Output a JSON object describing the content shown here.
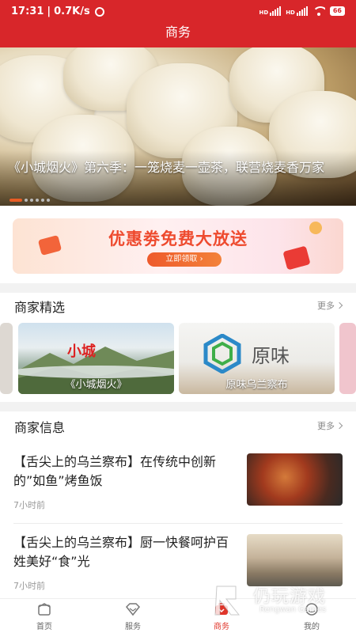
{
  "status_bar": {
    "time": "17:31",
    "speed": "0.7K/s",
    "battery": "66"
  },
  "header": {
    "title": "商务"
  },
  "banner": {
    "caption": "《小城烟火》第六季：一笼烧麦一壶茶，联营烧麦香万家",
    "page_indicator": {
      "total": 6,
      "current": 1
    }
  },
  "coupon": {
    "headline": "优惠劵免费大放送",
    "button_label": "立即领取"
  },
  "featured": {
    "title": "商家精选",
    "more_label": "更多",
    "cards": [
      {
        "name": "《小城烟火》"
      },
      {
        "name": "原味乌兰察布"
      }
    ]
  },
  "news": {
    "title": "商家信息",
    "more_label": "更多",
    "items": [
      {
        "title": "【舌尖上的乌兰察布】在传统中创新的”如鱼”烤鱼饭",
        "time": "7小时前"
      },
      {
        "title": "【舌尖上的乌兰察布】厨一快餐呵护百姓美好“食”光",
        "time": "7小时前"
      }
    ]
  },
  "tabbar": {
    "items": [
      {
        "label": "首页",
        "active": false
      },
      {
        "label": "服务",
        "active": false
      },
      {
        "label": "商务",
        "active": true
      },
      {
        "label": "我的",
        "active": false
      }
    ]
  },
  "watermark": {
    "text": "仍玩游戏",
    "sub": "Rengwan Games"
  },
  "colors": {
    "brand_red": "#d8262a",
    "accent_orange": "#e85c24"
  }
}
